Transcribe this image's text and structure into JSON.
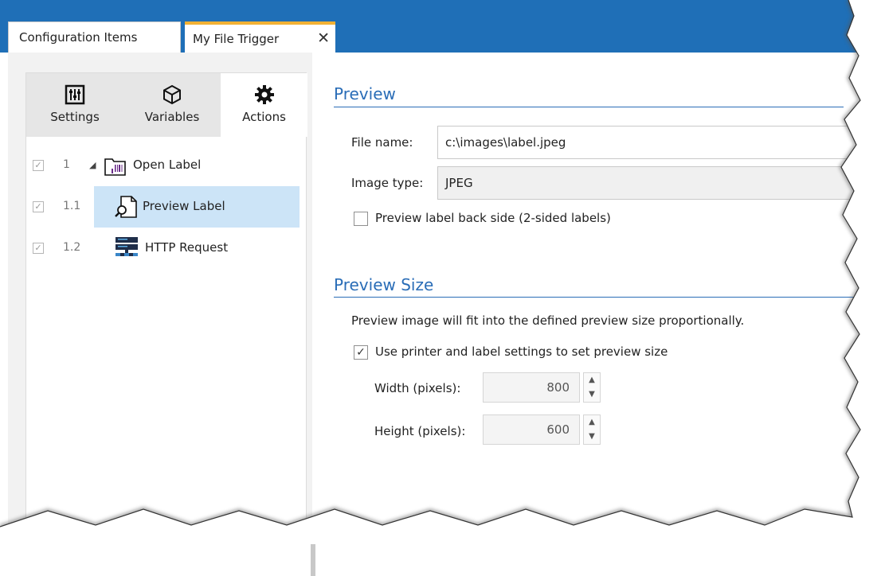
{
  "tabs": {
    "configuration_items": "Configuration Items",
    "my_file_trigger": "My File Trigger",
    "close_glyph": "✕"
  },
  "sidebar_tabs": {
    "settings": "Settings",
    "variables": "Variables",
    "actions": "Actions"
  },
  "actions_tree": [
    {
      "num": "1",
      "label": "Open Label",
      "checked": true,
      "icon": "open-label-icon"
    },
    {
      "num": "1.1",
      "label": "Preview Label",
      "checked": true,
      "icon": "preview-label-icon",
      "selected": true
    },
    {
      "num": "1.2",
      "label": "HTTP Request",
      "checked": true,
      "icon": "http-request-icon"
    }
  ],
  "preview": {
    "title": "Preview",
    "file_name_label": "File name:",
    "file_name_value": "c:\\images\\label.jpeg",
    "image_type_label": "Image type:",
    "image_type_value": "JPEG",
    "back_side_label": "Preview label back side (2-sided labels)",
    "back_side_checked": false
  },
  "preview_size": {
    "title": "Preview Size",
    "description": "Preview image will fit into the defined preview size proportionally.",
    "use_settings_label": "Use printer and label settings to set preview size",
    "use_settings_checked": true,
    "width_label": "Width (pixels):",
    "width_value": "800",
    "height_label": "Height (pixels):",
    "height_value": "600"
  },
  "colors": {
    "accent": "#2a6db7",
    "topbar": "#1f6fb7",
    "active_tab_marker": "#f2b134",
    "selection": "#cce4f7"
  }
}
